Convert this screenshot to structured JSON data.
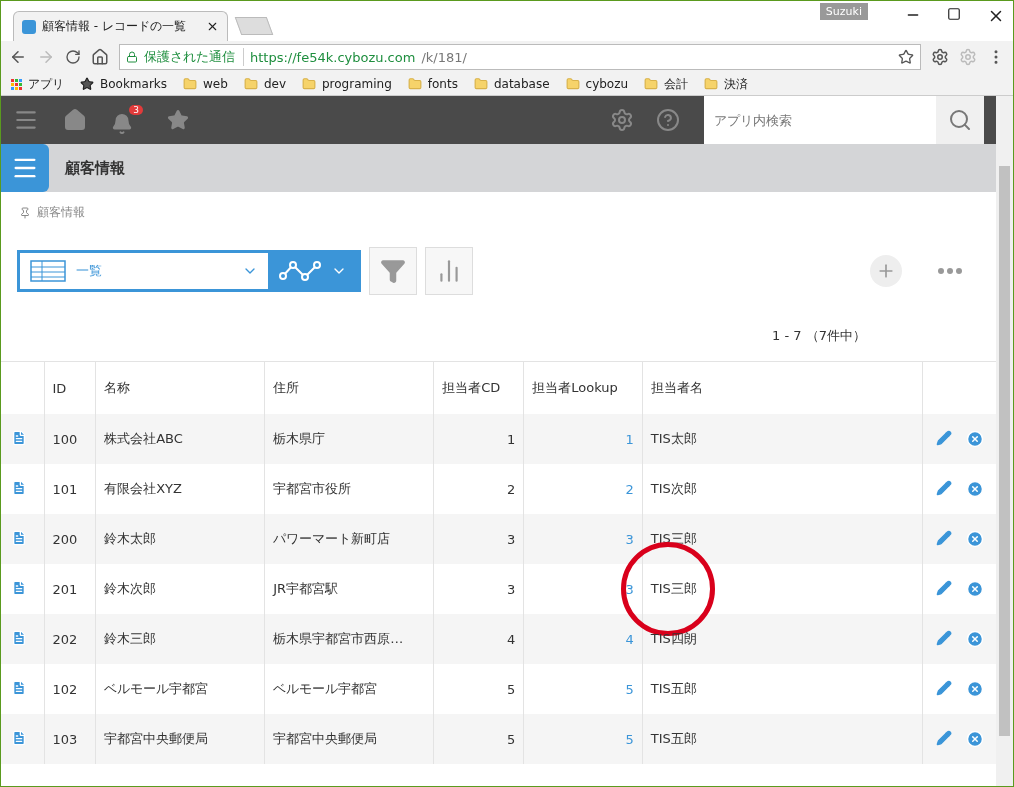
{
  "browser": {
    "tab_title": "顧客情報 - レコードの一覧",
    "profile": "Suzuki",
    "secure_label": "保護された通信",
    "url_host": "https://fe54k.cybozu.com",
    "url_path": "/k/181/",
    "bookmarks": [
      {
        "kind": "apps",
        "label": "アプリ"
      },
      {
        "kind": "star",
        "label": "Bookmarks"
      },
      {
        "kind": "folder",
        "label": "web"
      },
      {
        "kind": "folder",
        "label": "dev"
      },
      {
        "kind": "folder",
        "label": "programing"
      },
      {
        "kind": "folder",
        "label": "fonts"
      },
      {
        "kind": "folder",
        "label": "database"
      },
      {
        "kind": "folder",
        "label": "cybozu"
      },
      {
        "kind": "folder",
        "label": "会計"
      },
      {
        "kind": "folder",
        "label": "決済"
      }
    ]
  },
  "header": {
    "notification_count": "3",
    "search": {
      "placeholder": "アプリ内検索"
    }
  },
  "app": {
    "title": "顧客情報",
    "breadcrumb": "顧客情報",
    "view": "一覧",
    "pagination": "1 - 7 （7件中）"
  },
  "table": {
    "columns": [
      "ID",
      "名称",
      "住所",
      "担当者CD",
      "担当者Lookup",
      "担当者名"
    ],
    "rows": [
      {
        "cells": [
          "100",
          "株式会社ABC",
          "栃木県庁",
          "1",
          "1",
          "TIS太郎"
        ]
      },
      {
        "cells": [
          "101",
          "有限会社XYZ",
          "宇都宮市役所",
          "2",
          "2",
          "TIS次郎"
        ]
      },
      {
        "cells": [
          "200",
          "鈴木太郎",
          "パワーマート新町店",
          "3",
          "3",
          "TIS三郎"
        ]
      },
      {
        "cells": [
          "201",
          "鈴木次郎",
          "JR宇都宮駅",
          "3",
          "3",
          "TIS三郎"
        ],
        "circled": true
      },
      {
        "cells": [
          "202",
          "鈴木三郎",
          "栃木県宇都宮市西原…",
          "4",
          "4",
          "TIS四朗"
        ]
      },
      {
        "cells": [
          "102",
          "ベルモール宇都宮",
          "ベルモール宇都宮",
          "5",
          "5",
          "TIS五郎"
        ]
      },
      {
        "cells": [
          "103",
          "宇都宮中央郵便局",
          "宇都宮中央郵便局",
          "5",
          "5",
          "TIS五郎"
        ]
      }
    ]
  },
  "annotation": {
    "kind": "circle"
  }
}
